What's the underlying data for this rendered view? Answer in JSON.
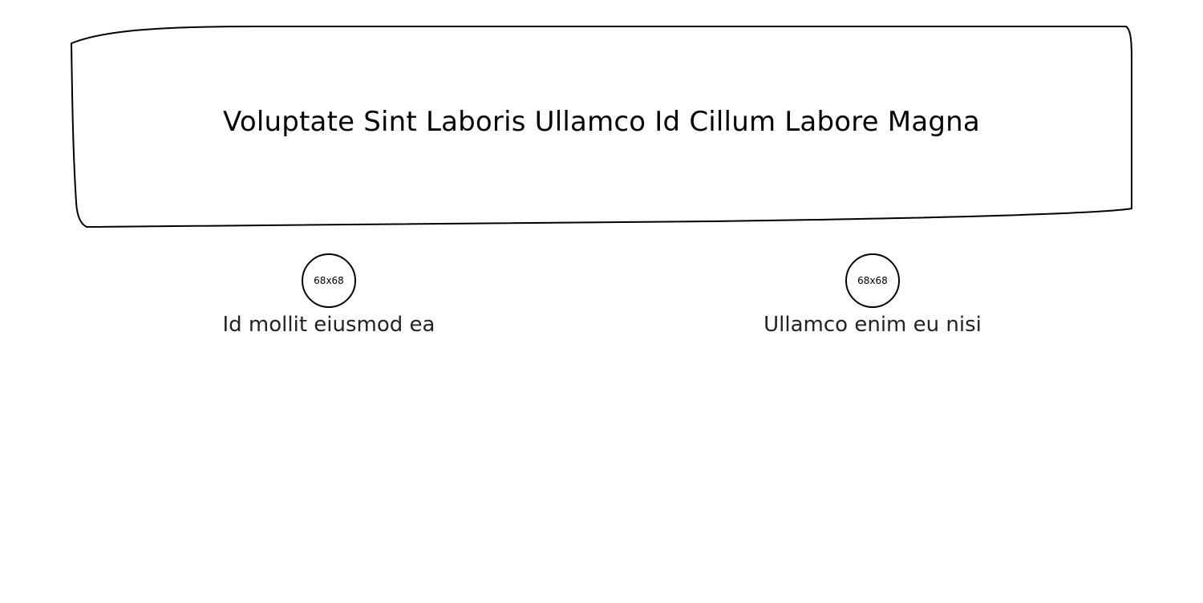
{
  "banner": {
    "title": "Voluptate Sint Laboris Ullamco Id Cillum Labore Magna"
  },
  "features": [
    {
      "avatar_text": "68x68",
      "label": "Id mollit eiusmod ea"
    },
    {
      "avatar_text": "68x68",
      "label": "Ullamco enim eu nisi"
    }
  ]
}
